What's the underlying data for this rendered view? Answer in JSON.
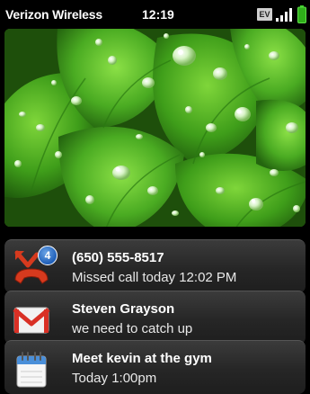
{
  "status_bar": {
    "carrier": "Verizon Wireless",
    "time": "12:19",
    "network_badge": "EV",
    "signal_icon": "signal-bars-icon",
    "battery_icon": "battery-icon"
  },
  "wallpaper": {
    "description_icon": "wallpaper-image"
  },
  "notifications": [
    {
      "icon": "missed-call-icon",
      "badge_count": "4",
      "title": "(650) 555-8517",
      "subtitle": "Missed call today 12:02 PM"
    },
    {
      "icon": "gmail-icon",
      "title": "Steven Grayson",
      "subtitle": "we need to catch up"
    },
    {
      "icon": "calendar-icon",
      "title": "Meet kevin at the gym",
      "subtitle": "Today 1:00pm"
    }
  ],
  "colors": {
    "accent_green": "#2fae1a",
    "badge_blue": "#1f5fb8",
    "missed_call_red": "#d63a1e"
  }
}
